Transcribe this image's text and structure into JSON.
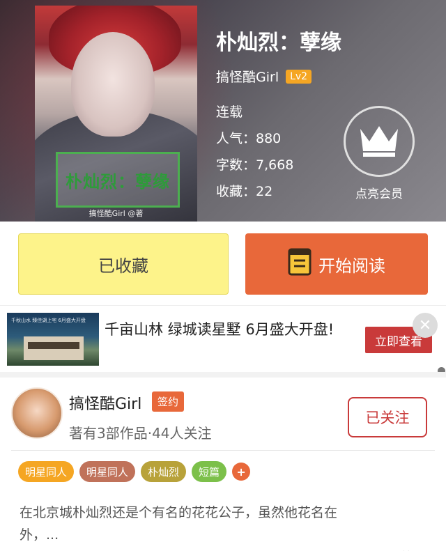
{
  "book": {
    "title": "朴灿烈：孽缘",
    "cover_title": "朴灿烈：孽缘",
    "cover_credit": "搞怪酷Girl @著",
    "author": "搞怪酷Girl",
    "level": "Lv2",
    "status": "连载",
    "popularity": "人气：880",
    "word_count": "字数：7,668",
    "favorites": "收藏：22"
  },
  "vip": {
    "label": "点亮会员",
    "icon": "crown-icon"
  },
  "actions": {
    "collected_label": "已收藏",
    "read_label": "开始阅读",
    "read_icon": "book-icon"
  },
  "ad": {
    "image_caption": "千秋山水 臻佳湖上宅 6月盛大开盘",
    "text": "千亩山林 绿城读星墅 6月盛大开盘!",
    "button": "立即查看",
    "close": "✕"
  },
  "author_card": {
    "name": "搞怪酷Girl",
    "badge": "签约",
    "meta": "著有3部作品·44人关注",
    "follow_label": "已关注"
  },
  "tags": [
    {
      "label": "明星同人",
      "color": "#f5a623"
    },
    {
      "label": "明星同人",
      "color": "#c0725a"
    },
    {
      "label": "朴灿烈",
      "color": "#b8a23a"
    },
    {
      "label": "短篇",
      "color": "#7cc04a"
    }
  ],
  "synopsis": "在北京城朴灿烈还是个有名的花花公子，虽然他花名在外，...",
  "colors": {
    "accent": "#e8683a",
    "collect_bg": "#fdf38a",
    "follow": "#c93a3a"
  }
}
